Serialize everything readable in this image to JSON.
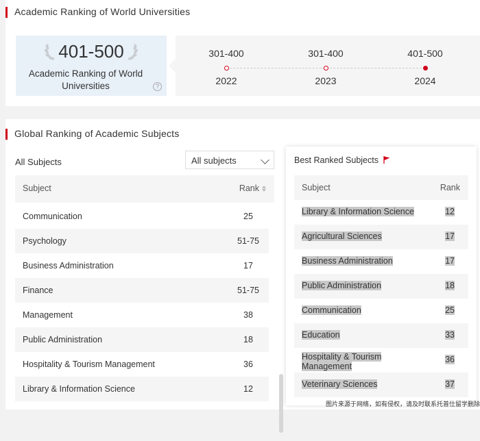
{
  "arwu": {
    "section_title": "Academic Ranking of World Universities",
    "current_rank": "401-500",
    "card_label": "Academic Ranking of World Universities",
    "history": [
      {
        "rank": "301-400",
        "year": "2022"
      },
      {
        "rank": "301-400",
        "year": "2023"
      },
      {
        "rank": "401-500",
        "year": "2024"
      }
    ]
  },
  "subjects": {
    "section_title": "Global Ranking of Academic Subjects",
    "all_label": "All Subjects",
    "select_value": "All subjects",
    "col_subject": "Subject",
    "col_rank": "Rank",
    "rows": [
      {
        "subject": "Communication",
        "rank": "25"
      },
      {
        "subject": "Psychology",
        "rank": "51-75"
      },
      {
        "subject": "Business Administration",
        "rank": "17"
      },
      {
        "subject": "Finance",
        "rank": "51-75"
      },
      {
        "subject": "Management",
        "rank": "38"
      },
      {
        "subject": "Public Administration",
        "rank": "18"
      },
      {
        "subject": "Hospitality & Tourism Management",
        "rank": "36"
      },
      {
        "subject": "Library & Information Science",
        "rank": "12"
      }
    ]
  },
  "best": {
    "title": "Best Ranked Subjects",
    "col_subject": "Subject",
    "col_rank": "Rank",
    "rows": [
      {
        "subject": "Library & Information Science",
        "rank": "12"
      },
      {
        "subject": "Agricultural Sciences",
        "rank": "17"
      },
      {
        "subject": "Business Administration",
        "rank": "17"
      },
      {
        "subject": "Public Administration",
        "rank": "18"
      },
      {
        "subject": "Communication",
        "rank": "25"
      },
      {
        "subject": "Education",
        "rank": "33"
      },
      {
        "subject": "Hospitality & Tourism Management",
        "rank": "36"
      },
      {
        "subject": "Veterinary Sciences",
        "rank": "37"
      }
    ]
  },
  "watermark": "图片来源于网络，如有侵权，请及时联系托普仕留学删除",
  "colors": {
    "accent": "#d0021b",
    "card_bg": "#e8f0f8"
  }
}
